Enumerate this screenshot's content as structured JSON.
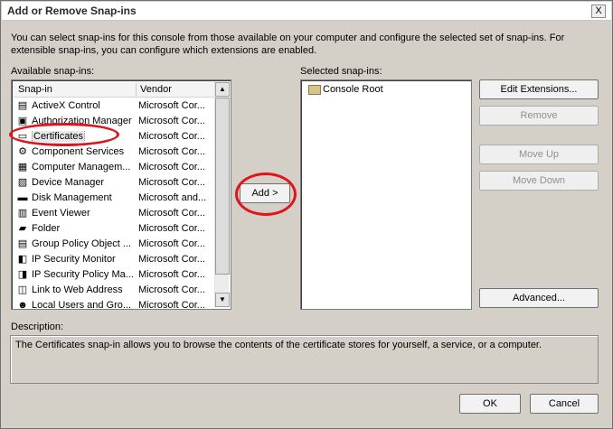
{
  "window": {
    "title": "Add or Remove Snap-ins",
    "close_glyph": "X"
  },
  "intro": "You can select snap-ins for this console from those available on your computer and configure the selected set of snap-ins. For extensible snap-ins, you can configure which extensions are enabled.",
  "available": {
    "label": "Available snap-ins:",
    "columns": [
      "Snap-in",
      "Vendor"
    ],
    "rows": [
      {
        "name": "ActiveX Control",
        "vendor": "Microsoft Cor...",
        "icon": "activex-icon",
        "glyph": "▤"
      },
      {
        "name": "Authorization Manager",
        "vendor": "Microsoft Cor...",
        "icon": "authorization-icon",
        "glyph": "▣"
      },
      {
        "name": "Certificates",
        "vendor": "Microsoft Cor...",
        "icon": "certificate-icon",
        "glyph": "▭"
      },
      {
        "name": "Component Services",
        "vendor": "Microsoft Cor...",
        "icon": "component-icon",
        "glyph": "⚙"
      },
      {
        "name": "Computer Managem...",
        "vendor": "Microsoft Cor...",
        "icon": "computer-icon",
        "glyph": "▦"
      },
      {
        "name": "Device Manager",
        "vendor": "Microsoft Cor...",
        "icon": "device-icon",
        "glyph": "▧"
      },
      {
        "name": "Disk Management",
        "vendor": "Microsoft and...",
        "icon": "disk-icon",
        "glyph": "▬"
      },
      {
        "name": "Event Viewer",
        "vendor": "Microsoft Cor...",
        "icon": "event-icon",
        "glyph": "▥"
      },
      {
        "name": "Folder",
        "vendor": "Microsoft Cor...",
        "icon": "folder-icon",
        "glyph": "▰"
      },
      {
        "name": "Group Policy Object ...",
        "vendor": "Microsoft Cor...",
        "icon": "policy-icon",
        "glyph": "▤"
      },
      {
        "name": "IP Security Monitor",
        "vendor": "Microsoft Cor...",
        "icon": "ip-security-icon",
        "glyph": "◧"
      },
      {
        "name": "IP Security Policy Ma...",
        "vendor": "Microsoft Cor...",
        "icon": "ip-policy-icon",
        "glyph": "◨"
      },
      {
        "name": "Link to Web Address",
        "vendor": "Microsoft Cor...",
        "icon": "link-icon",
        "glyph": "◫"
      },
      {
        "name": "Local Users and Gro...",
        "vendor": "Microsoft Cor...",
        "icon": "users-icon",
        "glyph": "☻"
      }
    ],
    "selected_index": 2,
    "scroll_up": "▲",
    "scroll_down": "▼"
  },
  "add_button": "Add >",
  "selected": {
    "label": "Selected snap-ins:",
    "items": [
      {
        "name": "Console Root",
        "icon": "folder-icon"
      }
    ]
  },
  "buttons": {
    "edit_extensions": "Edit Extensions...",
    "remove": "Remove",
    "move_up": "Move Up",
    "move_down": "Move Down",
    "advanced": "Advanced...",
    "ok": "OK",
    "cancel": "Cancel"
  },
  "description": {
    "label": "Description:",
    "text": "The Certificates snap-in allows you to browse the contents of the certificate stores for yourself, a service, or a computer."
  },
  "colors": {
    "highlight_ellipse": "#e0151b",
    "dialog_bg": "#d4d0c8"
  }
}
